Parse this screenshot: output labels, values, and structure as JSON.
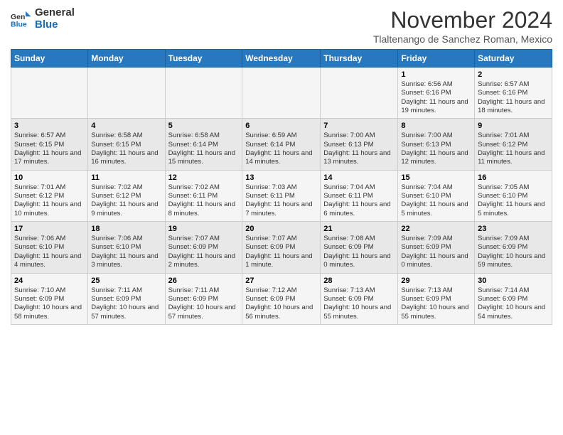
{
  "header": {
    "logo_line1": "General",
    "logo_line2": "Blue",
    "month": "November 2024",
    "location": "Tlaltenango de Sanchez Roman, Mexico"
  },
  "weekdays": [
    "Sunday",
    "Monday",
    "Tuesday",
    "Wednesday",
    "Thursday",
    "Friday",
    "Saturday"
  ],
  "weeks": [
    [
      {
        "day": "",
        "info": ""
      },
      {
        "day": "",
        "info": ""
      },
      {
        "day": "",
        "info": ""
      },
      {
        "day": "",
        "info": ""
      },
      {
        "day": "",
        "info": ""
      },
      {
        "day": "1",
        "info": "Sunrise: 6:56 AM\nSunset: 6:16 PM\nDaylight: 11 hours and 19 minutes."
      },
      {
        "day": "2",
        "info": "Sunrise: 6:57 AM\nSunset: 6:16 PM\nDaylight: 11 hours and 18 minutes."
      }
    ],
    [
      {
        "day": "3",
        "info": "Sunrise: 6:57 AM\nSunset: 6:15 PM\nDaylight: 11 hours and 17 minutes."
      },
      {
        "day": "4",
        "info": "Sunrise: 6:58 AM\nSunset: 6:15 PM\nDaylight: 11 hours and 16 minutes."
      },
      {
        "day": "5",
        "info": "Sunrise: 6:58 AM\nSunset: 6:14 PM\nDaylight: 11 hours and 15 minutes."
      },
      {
        "day": "6",
        "info": "Sunrise: 6:59 AM\nSunset: 6:14 PM\nDaylight: 11 hours and 14 minutes."
      },
      {
        "day": "7",
        "info": "Sunrise: 7:00 AM\nSunset: 6:13 PM\nDaylight: 11 hours and 13 minutes."
      },
      {
        "day": "8",
        "info": "Sunrise: 7:00 AM\nSunset: 6:13 PM\nDaylight: 11 hours and 12 minutes."
      },
      {
        "day": "9",
        "info": "Sunrise: 7:01 AM\nSunset: 6:12 PM\nDaylight: 11 hours and 11 minutes."
      }
    ],
    [
      {
        "day": "10",
        "info": "Sunrise: 7:01 AM\nSunset: 6:12 PM\nDaylight: 11 hours and 10 minutes."
      },
      {
        "day": "11",
        "info": "Sunrise: 7:02 AM\nSunset: 6:12 PM\nDaylight: 11 hours and 9 minutes."
      },
      {
        "day": "12",
        "info": "Sunrise: 7:02 AM\nSunset: 6:11 PM\nDaylight: 11 hours and 8 minutes."
      },
      {
        "day": "13",
        "info": "Sunrise: 7:03 AM\nSunset: 6:11 PM\nDaylight: 11 hours and 7 minutes."
      },
      {
        "day": "14",
        "info": "Sunrise: 7:04 AM\nSunset: 6:11 PM\nDaylight: 11 hours and 6 minutes."
      },
      {
        "day": "15",
        "info": "Sunrise: 7:04 AM\nSunset: 6:10 PM\nDaylight: 11 hours and 5 minutes."
      },
      {
        "day": "16",
        "info": "Sunrise: 7:05 AM\nSunset: 6:10 PM\nDaylight: 11 hours and 5 minutes."
      }
    ],
    [
      {
        "day": "17",
        "info": "Sunrise: 7:06 AM\nSunset: 6:10 PM\nDaylight: 11 hours and 4 minutes."
      },
      {
        "day": "18",
        "info": "Sunrise: 7:06 AM\nSunset: 6:10 PM\nDaylight: 11 hours and 3 minutes."
      },
      {
        "day": "19",
        "info": "Sunrise: 7:07 AM\nSunset: 6:09 PM\nDaylight: 11 hours and 2 minutes."
      },
      {
        "day": "20",
        "info": "Sunrise: 7:07 AM\nSunset: 6:09 PM\nDaylight: 11 hours and 1 minute."
      },
      {
        "day": "21",
        "info": "Sunrise: 7:08 AM\nSunset: 6:09 PM\nDaylight: 11 hours and 0 minutes."
      },
      {
        "day": "22",
        "info": "Sunrise: 7:09 AM\nSunset: 6:09 PM\nDaylight: 11 hours and 0 minutes."
      },
      {
        "day": "23",
        "info": "Sunrise: 7:09 AM\nSunset: 6:09 PM\nDaylight: 10 hours and 59 minutes."
      }
    ],
    [
      {
        "day": "24",
        "info": "Sunrise: 7:10 AM\nSunset: 6:09 PM\nDaylight: 10 hours and 58 minutes."
      },
      {
        "day": "25",
        "info": "Sunrise: 7:11 AM\nSunset: 6:09 PM\nDaylight: 10 hours and 57 minutes."
      },
      {
        "day": "26",
        "info": "Sunrise: 7:11 AM\nSunset: 6:09 PM\nDaylight: 10 hours and 57 minutes."
      },
      {
        "day": "27",
        "info": "Sunrise: 7:12 AM\nSunset: 6:09 PM\nDaylight: 10 hours and 56 minutes."
      },
      {
        "day": "28",
        "info": "Sunrise: 7:13 AM\nSunset: 6:09 PM\nDaylight: 10 hours and 55 minutes."
      },
      {
        "day": "29",
        "info": "Sunrise: 7:13 AM\nSunset: 6:09 PM\nDaylight: 10 hours and 55 minutes."
      },
      {
        "day": "30",
        "info": "Sunrise: 7:14 AM\nSunset: 6:09 PM\nDaylight: 10 hours and 54 minutes."
      }
    ]
  ]
}
